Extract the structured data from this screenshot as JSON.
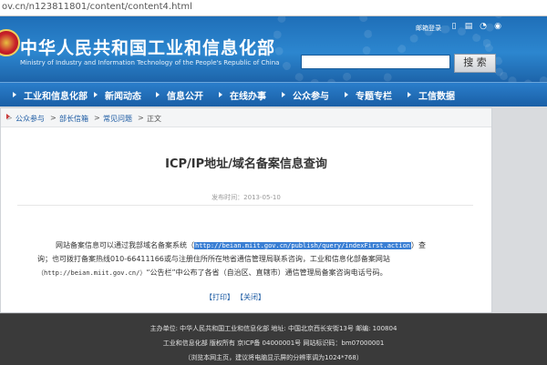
{
  "browser": {
    "url": "ov.cn/n123811801/content/content4.html"
  },
  "header": {
    "title": "中华人民共和国工业和信息化部",
    "subtitle": "Ministry of Industry and Information Technology of the People's Republic of China",
    "top_links": "邮箱登录",
    "icons": [
      "phone-icon",
      "wap-icon",
      "rss-icon",
      "weibo-icon"
    ],
    "search_placeholder": "",
    "search_button": "搜 索"
  },
  "nav": {
    "items": [
      "工业和信息化部",
      "新闻动态",
      "信息公开",
      "在线办事",
      "公众参与",
      "专题专栏",
      "工信数据"
    ]
  },
  "breadcrumb": {
    "items": [
      "公众参与",
      "部长信箱",
      "常见问题",
      "正文"
    ],
    "separator": ">"
  },
  "article": {
    "title": "ICP/IP地址/域名备案信息查询",
    "publish_time": "发布时间：2013-05-10",
    "p1_start": "网站备案信息可以通过我部域名备案系统（",
    "p1_link": "http://beian.miit.gov.cn/publish/query/indexFirst.action",
    "p1_end": "）查",
    "p2": "询；也可拨打备案热线010-66411166或与注册住所所在地省通信管理局联系咨询，工业和信息化部备案网站",
    "p3_link": "（http://beian.miit.gov.cn/）",
    "p3_rest": "“公告栏”中公布了各省（自治区、直辖市）通信管理局备案咨询电话号码。",
    "print": "【打印】",
    "close": "【关闭】"
  },
  "footer": {
    "line1": "主办单位: 中华人民共和国工业和信息化部 地址: 中国北京西长安街13号 邮编: 100804",
    "line2": "工业和信息化部 版权所有 京ICP备 04000001号    网站标识码：bm07000001",
    "line3": "（浏览本网主页，建议将电脑显示屏的分辨率调为1024*768）"
  },
  "colors": {
    "header_blue": "#1f6fb8",
    "nav_blue": "#1a5fa6",
    "link_blue": "#1b5aa3",
    "footer_bg": "#3a3a3a",
    "highlight": "#3a7fd4"
  }
}
